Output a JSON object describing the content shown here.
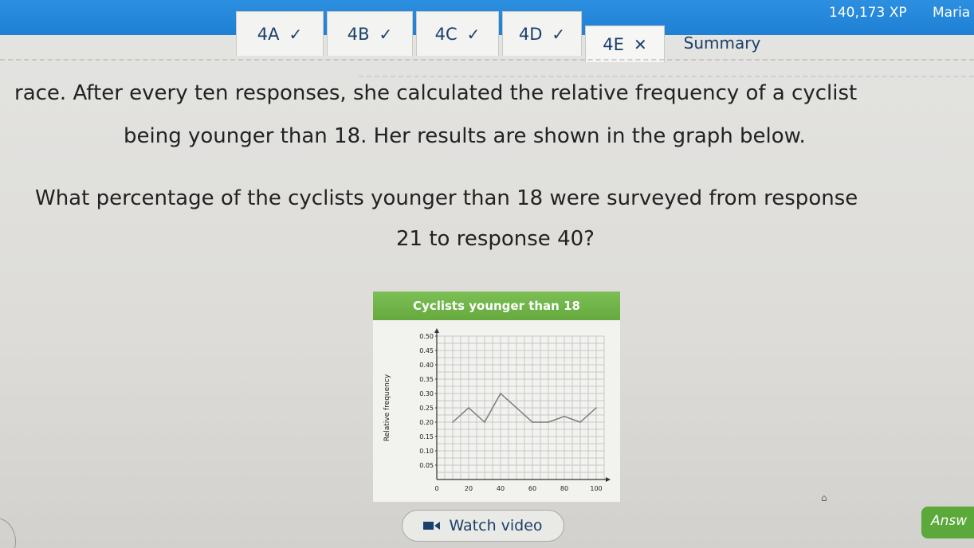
{
  "header": {
    "xp": "140,173 XP",
    "user": "Maria"
  },
  "tabs": [
    {
      "label": "4A",
      "status": "✓"
    },
    {
      "label": "4B",
      "status": "✓"
    },
    {
      "label": "4C",
      "status": "✓"
    },
    {
      "label": "4D",
      "status": "✓"
    },
    {
      "label": "4E",
      "status": "✕"
    },
    {
      "label": "Summary",
      "status": ""
    }
  ],
  "question": {
    "line1": "race. After every ten responses, she calculated the relative frequency of a cyclist",
    "line2": "being younger than 18. Her results are shown in the graph below.",
    "line3": "What percentage of the cyclists younger than 18 were surveyed from response",
    "line4": "21 to response 40?"
  },
  "chart_data": {
    "type": "line",
    "title": "Cyclists younger than 18",
    "xlabel": "",
    "ylabel": "Relative frequency",
    "x": [
      10,
      20,
      30,
      40,
      50,
      60,
      70,
      80,
      90,
      100
    ],
    "y": [
      0.2,
      0.25,
      0.2,
      0.3,
      0.25,
      0.2,
      0.2,
      0.22,
      0.2,
      0.25
    ],
    "xticks": [
      "0",
      "20",
      "40",
      "60",
      "80",
      "100"
    ],
    "yticks": [
      "0.05",
      "0.10",
      "0.15",
      "0.20",
      "0.25",
      "0.30",
      "0.35",
      "0.40",
      "0.45",
      "0.50"
    ],
    "xlim": [
      0,
      100
    ],
    "ylim": [
      0,
      0.5
    ],
    "grid": true,
    "colors": {
      "line": "#7a7a7a",
      "grid": "#c8c8c8",
      "header": "#6fb249"
    }
  },
  "actions": {
    "watch_video": "Watch video",
    "answer": "Answ"
  },
  "colors": {
    "topbar": "#2387dc",
    "tab_text": "#1a3f6b",
    "answer_button": "#5aa93a"
  }
}
